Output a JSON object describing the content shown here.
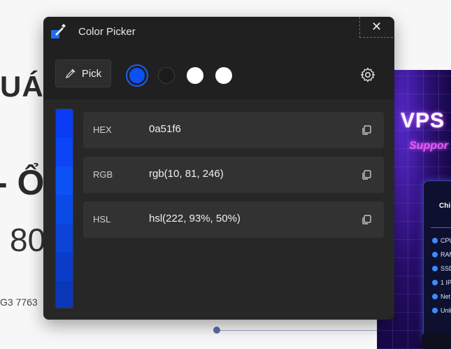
{
  "background": {
    "heading": "UÁ",
    "big": "- Ổ",
    "number": "80",
    "small": "G3 7763"
  },
  "banner": {
    "title": "VPS",
    "subtitle": "Suppor",
    "card_head": "Chi",
    "features": [
      "CPU",
      "RAM",
      "SSD",
      "1 IP",
      "Net",
      "Unli"
    ]
  },
  "window": {
    "title": "Color Picker",
    "close_glyph": "✕"
  },
  "toolbar": {
    "pick_label": "Pick",
    "swatches": [
      "#0a51f6",
      "#1b1b1b",
      "#ffffff",
      "#ffffff"
    ]
  },
  "shades": [
    "#0a3cf6",
    "#0a45f6",
    "#0a51f6",
    "#0a4ae6",
    "#0a43d6",
    "#0a3cc8",
    "#0a36b8"
  ],
  "formats": [
    {
      "label": "HEX",
      "value": "0a51f6"
    },
    {
      "label": "RGB",
      "value": "rgb(10, 81, 246)"
    },
    {
      "label": "HSL",
      "value": "hsl(222, 93%, 50%)"
    }
  ],
  "colors": {
    "accent": "#0a51f6",
    "window_bg": "#202020",
    "row_bg": "#323232"
  }
}
